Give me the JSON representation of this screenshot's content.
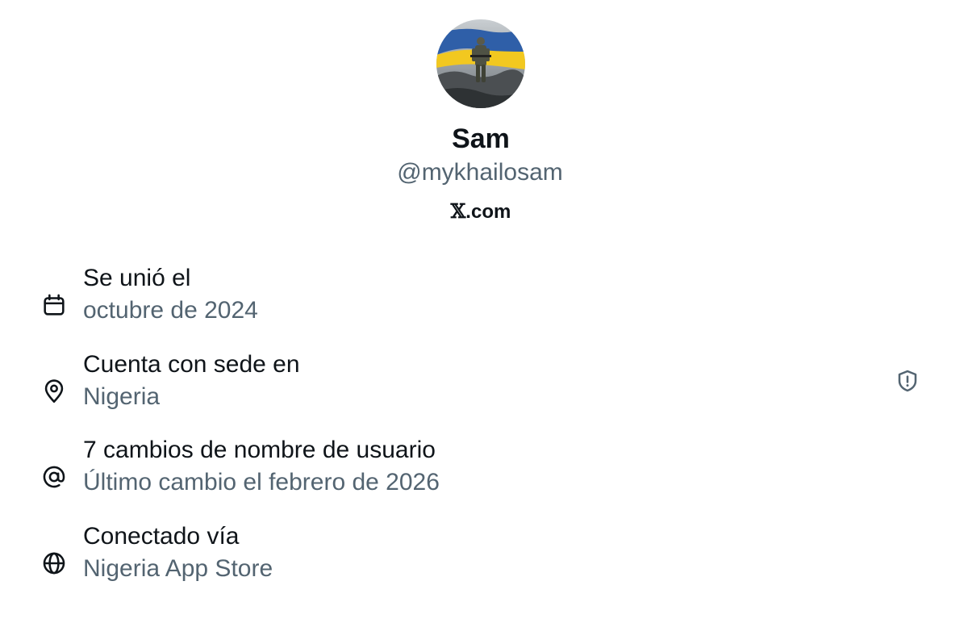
{
  "profile": {
    "display_name": "Sam",
    "handle": "@mykhailosam",
    "source_mark": "𝕏",
    "source_suffix": ".com"
  },
  "details": [
    {
      "icon": "calendar-icon",
      "title": "Se unió el",
      "value": "octubre de 2024"
    },
    {
      "icon": "location-pin-icon",
      "title": "Cuenta con sede en",
      "value": "Nigeria"
    },
    {
      "icon": "at-sign-icon",
      "title": "7 cambios de nombre de usuario",
      "value": "Último cambio el febrero de 2026"
    },
    {
      "icon": "globe-icon",
      "title": "Conectado vía",
      "value": "Nigeria App Store"
    }
  ],
  "side_icons": {
    "location_row": "shield-alert-icon"
  },
  "colors": {
    "primary_text": "#0f1419",
    "secondary_text": "#536471",
    "flag_blue": "#2f5fa8",
    "flag_yellow": "#f2c820"
  }
}
